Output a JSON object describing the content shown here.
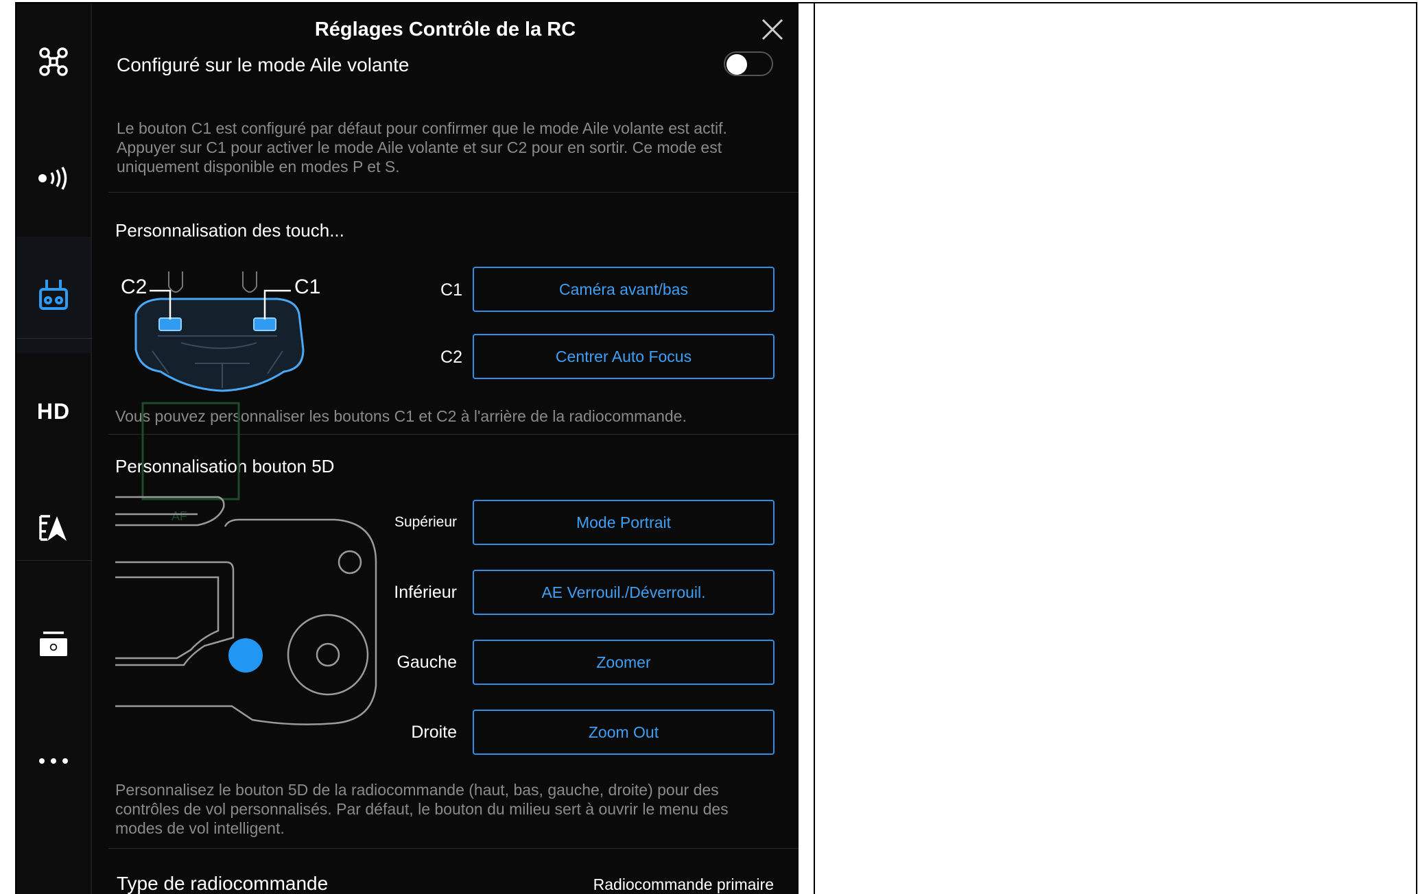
{
  "header": {
    "title": "Réglages Contrôle de la RC"
  },
  "sidebar": {
    "items": [
      {
        "icon": "drone-icon"
      },
      {
        "icon": "signal-icon"
      },
      {
        "icon": "remote-controller-icon",
        "active": true
      },
      {
        "label": "HD"
      },
      {
        "icon": "map-icon"
      },
      {
        "icon": "camera-icon"
      },
      {
        "icon": "more-icon"
      }
    ]
  },
  "flying_wing": {
    "label": "Configuré sur le mode Aile volante",
    "enabled": false,
    "description": "Le bouton C1 est configuré par défaut pour confirmer que le mode Aile volante est actif. Appuyer sur C1 pour activer le mode Aile volante et sur C2 pour en sortir. Ce mode est uniquement disponible en modes P et S."
  },
  "custom_buttons": {
    "title": "Personnalisation des touch...",
    "diagram_labels": {
      "c2": "C2",
      "c1": "C1"
    },
    "c1_label": "C1",
    "c1_value": "Caméra avant/bas",
    "c2_label": "C2",
    "c2_value": "Centrer Auto Focus",
    "description": "Vous pouvez personnaliser les boutons C1 et C2 à l'arrière de la radiocommande."
  },
  "five_d": {
    "title": "Personnalisation bouton 5D",
    "overlay_text": "AF",
    "up_label": "Supérieur",
    "up_value": "Mode Portrait",
    "down_label": "Inférieur",
    "down_value": "AE Verrouil./Déverrouil.",
    "left_label": "Gauche",
    "left_value": "Zoomer",
    "right_label": "Droite",
    "right_value": "Zoom Out",
    "description": "Personnalisez le bouton 5D de la radiocommande (haut, bas, gauche, droite) pour des contrôles de vol personnalisés. Par défaut, le bouton du milieu sert à ouvrir le menu des modes de vol intelligent."
  },
  "rc_type": {
    "label": "Type de radiocommande",
    "value": "Radiocommande primaire"
  },
  "colors": {
    "accent": "#2f8fe6",
    "background": "#0a0a0a",
    "button_fill": "#2196f3"
  }
}
